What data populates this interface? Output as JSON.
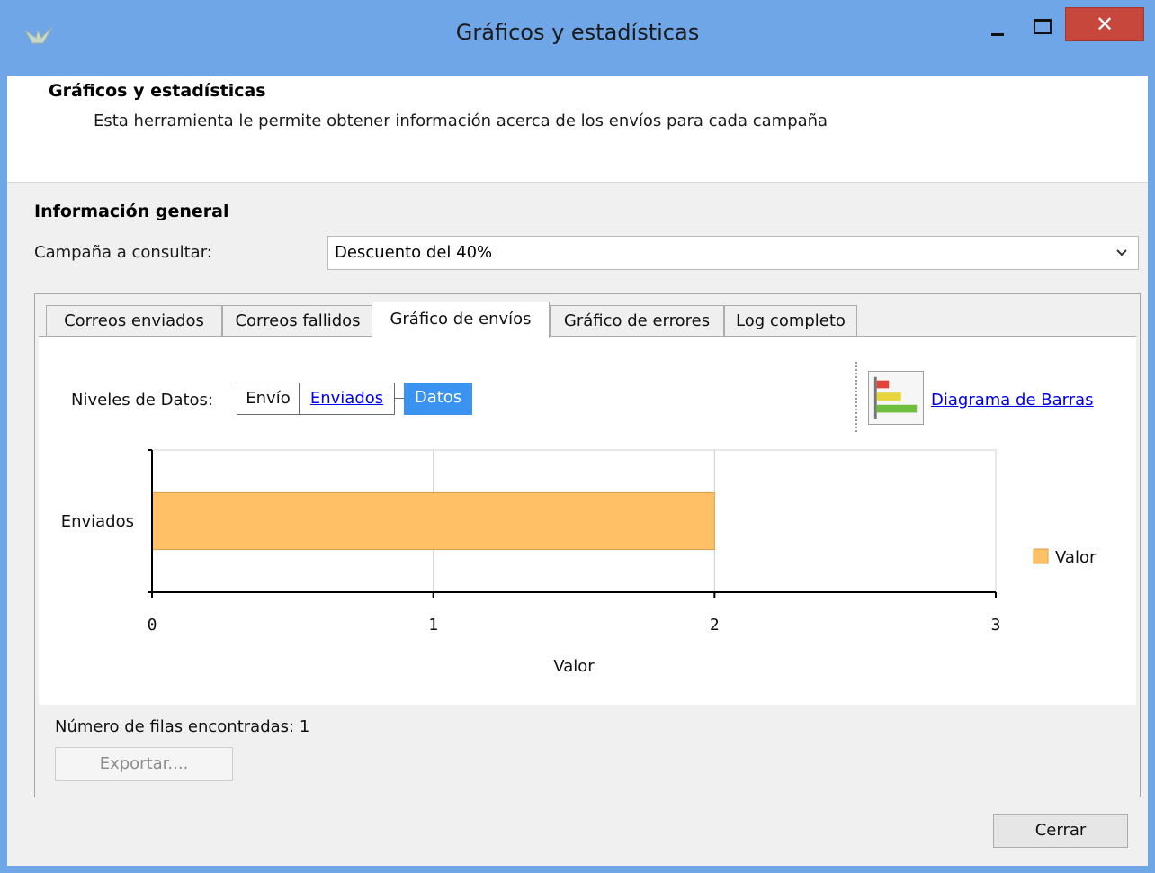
{
  "window": {
    "title": "Gráficos y estadísticas",
    "close_glyph": "✕"
  },
  "header": {
    "title": "Gráficos y estadísticas",
    "description": "Esta herramienta le permite obtener información acerca de los envíos para cada campaña"
  },
  "general": {
    "section_title": "Información general",
    "campaign_label": "Campaña a consultar:",
    "campaign_value": "Descuento del 40%"
  },
  "tabs": [
    {
      "label": "Correos enviados",
      "active": false
    },
    {
      "label": "Correos fallidos",
      "active": false
    },
    {
      "label": "Gráfico de envíos",
      "active": true
    },
    {
      "label": "Gráfico de errores",
      "active": false
    },
    {
      "label": "Log completo",
      "active": false
    }
  ],
  "levels": {
    "label": "Niveles de Datos:",
    "crumbs": [
      "Envío",
      "Enviados",
      "Datos"
    ]
  },
  "diagram_link": "Diagrama de Barras",
  "chart_data": {
    "type": "bar",
    "orientation": "horizontal",
    "categories": [
      "Enviados"
    ],
    "series": [
      {
        "name": "Valor",
        "values": [
          2
        ]
      }
    ],
    "xlabel": "Valor",
    "ylabel": "",
    "xlim": [
      0,
      3
    ],
    "xticks": [
      0,
      1,
      2,
      3
    ],
    "grid": true,
    "legend": "right",
    "colors": {
      "bar": "#ffc066",
      "bar_stroke": "#d9a04a"
    }
  },
  "footer": {
    "rows_label": "Número de filas encontradas:",
    "rows_count": "1",
    "export_label": "Exportar....",
    "close_label": "Cerrar"
  },
  "colors": {
    "titlebar": "#6ea6e8",
    "close_button": "#c7473c",
    "selected_crumb": "#3a93f0",
    "link": "#0000ee"
  }
}
